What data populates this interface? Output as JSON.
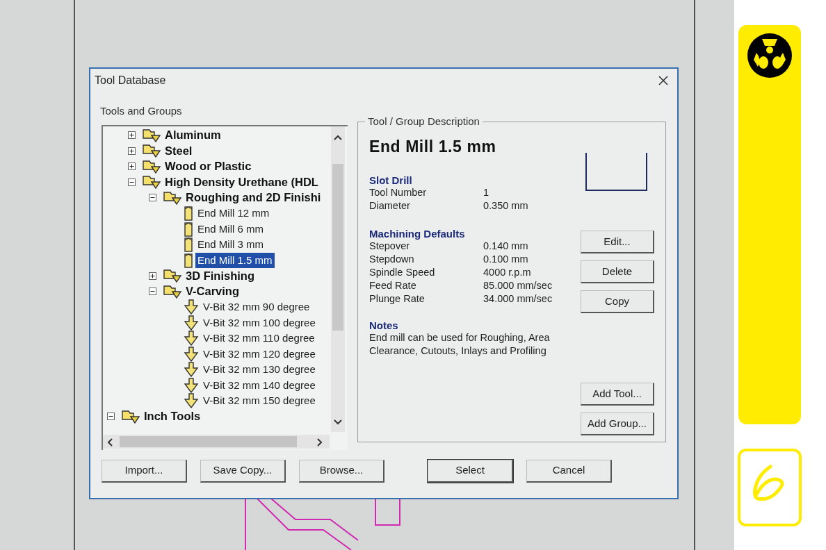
{
  "dialog": {
    "title": "Tool Database",
    "tree_label": "Tools and Groups",
    "tree": [
      {
        "children": [
          {
            "kind": "group",
            "label": "Aluminum",
            "expanded": false
          },
          {
            "kind": "group",
            "label": "Steel",
            "expanded": false
          },
          {
            "kind": "group",
            "label": "Wood or Plastic",
            "expanded": false
          },
          {
            "kind": "group",
            "label": "High Density Urethane (HDL",
            "expanded": true,
            "children": [
              {
                "kind": "group",
                "label": "Roughing and 2D Finishi",
                "expanded": true,
                "children": [
                  {
                    "kind": "end_mill",
                    "label": "End Mill 12 mm",
                    "selected": false
                  },
                  {
                    "kind": "end_mill",
                    "label": "End Mill 6 mm",
                    "selected": false
                  },
                  {
                    "kind": "end_mill",
                    "label": "End Mill 3 mm",
                    "selected": false
                  },
                  {
                    "kind": "end_mill",
                    "label": "End Mill 1.5 mm",
                    "selected": true
                  }
                ]
              },
              {
                "kind": "group",
                "label": "3D Finishing",
                "expanded": false
              },
              {
                "kind": "group",
                "label": "V-Carving",
                "expanded": true,
                "children": [
                  {
                    "kind": "v_bit",
                    "label": "V-Bit 32 mm 90 degree",
                    "selected": false
                  },
                  {
                    "kind": "v_bit",
                    "label": "V-Bit 32 mm 100 degree",
                    "selected": false
                  },
                  {
                    "kind": "v_bit",
                    "label": "V-Bit 32 mm 110 degree",
                    "selected": false
                  },
                  {
                    "kind": "v_bit",
                    "label": "V-Bit 32 mm 120 degree",
                    "selected": false
                  },
                  {
                    "kind": "v_bit",
                    "label": "V-Bit 32 mm 130 degree",
                    "selected": false
                  },
                  {
                    "kind": "v_bit",
                    "label": "V-Bit 32 mm 140 degree",
                    "selected": false
                  },
                  {
                    "kind": "v_bit",
                    "label": "V-Bit 32 mm 150 degree",
                    "selected": false
                  }
                ]
              }
            ]
          }
        ]
      },
      {
        "kind": "group",
        "label": "Inch Tools",
        "expanded": true
      }
    ],
    "description": {
      "group_label": "Tool / Group Description",
      "name": "End Mill 1.5 mm",
      "sections": [
        {
          "heading": "Slot Drill",
          "rows": [
            {
              "label": "Tool Number",
              "value": "1"
            },
            {
              "label": "Diameter",
              "value": "0.350 mm"
            }
          ]
        },
        {
          "heading": "Machining Defaults",
          "rows": [
            {
              "label": "Stepover",
              "value": "0.140 mm"
            },
            {
              "label": "Stepdown",
              "value": "0.100 mm"
            },
            {
              "label": "Spindle Speed",
              "value": "4000 r.p.m"
            },
            {
              "label": "Feed Rate",
              "value": "85.000 mm/sec"
            },
            {
              "label": "Plunge Rate",
              "value": "34.000 mm/sec"
            }
          ]
        }
      ],
      "notes_heading": "Notes",
      "notes": "End mill can be used for Roughing, Area Clearance, Cutouts, Inlays and Profiling",
      "side_buttons": [
        "Edit...",
        "Delete",
        "Copy"
      ],
      "add_buttons": [
        "Add Tool...",
        "Add Group..."
      ]
    },
    "bottom_buttons": [
      {
        "label": "Import...",
        "default": false
      },
      {
        "label": "Save Copy...",
        "default": false
      },
      {
        "label": "Browse...",
        "default": false
      },
      {
        "label": "Select",
        "default": true
      },
      {
        "label": "Cancel",
        "default": false
      }
    ]
  }
}
